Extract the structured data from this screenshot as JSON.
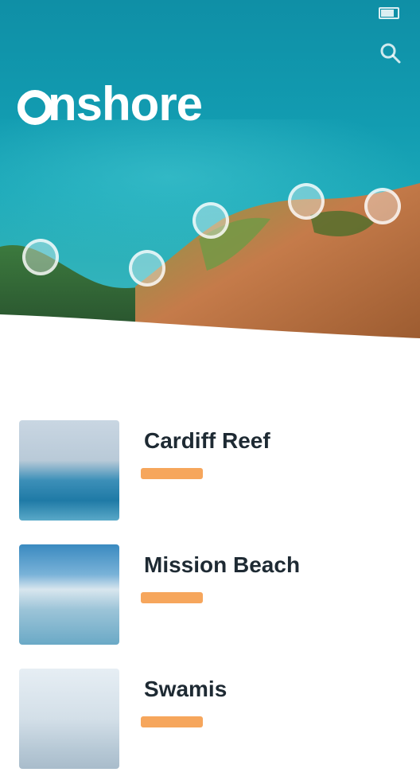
{
  "status_bar": {
    "carrier": "",
    "time": "",
    "battery": ""
  },
  "header": {
    "menu_label": "",
    "logo_text": "nshore",
    "location": "",
    "search_icon": "search-icon"
  },
  "colors": {
    "hero_teal": "#129cb1",
    "accent_orange": "#f6a65c",
    "title_dark": "#1e2a33"
  },
  "section_title": "",
  "spots": [
    {
      "number": "",
      "name": "Cardiff Reef",
      "rating": "",
      "meta": ""
    },
    {
      "number": "",
      "name": "Mission Beach",
      "rating": "",
      "meta": ""
    },
    {
      "number": "",
      "name": "Swamis",
      "rating": "",
      "meta": ""
    }
  ]
}
